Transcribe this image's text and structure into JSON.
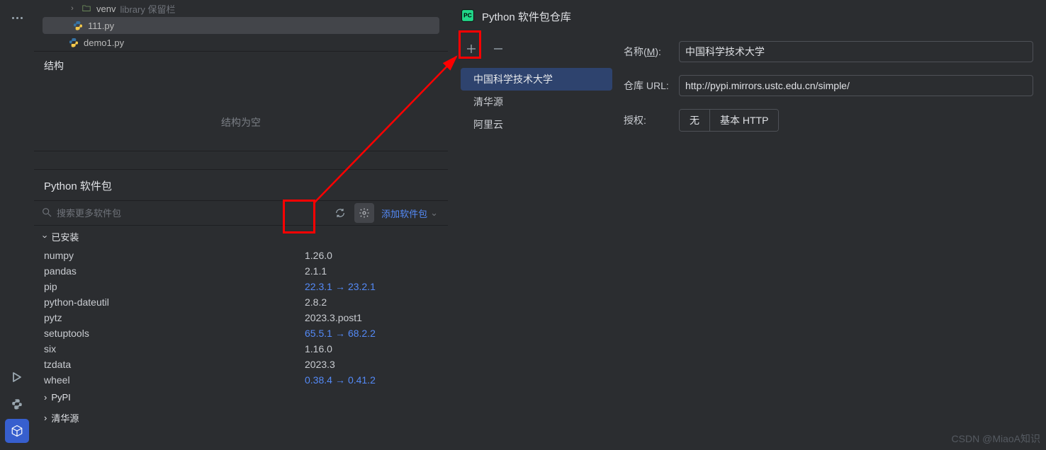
{
  "tree": {
    "venv_label": "venv",
    "venv_hint": "library 保留栏",
    "file1": "111.py",
    "file2": "demo1.py"
  },
  "structure": {
    "title": "结构",
    "empty": "结构为空"
  },
  "packages_panel": {
    "title": "Python 软件包",
    "search_placeholder": "搜索更多软件包",
    "add_package": "添加软件包",
    "installed_group": "已安装",
    "items": [
      {
        "name": "numpy",
        "version": "1.26.0"
      },
      {
        "name": "pandas",
        "version": "2.1.1"
      },
      {
        "name": "pip",
        "version": "22.3.1",
        "upgrade": "23.2.1"
      },
      {
        "name": "python-dateutil",
        "version": "2.8.2"
      },
      {
        "name": "pytz",
        "version": "2023.3.post1"
      },
      {
        "name": "setuptools",
        "version": "65.5.1",
        "upgrade": "68.2.2"
      },
      {
        "name": "six",
        "version": "1.16.0"
      },
      {
        "name": "tzdata",
        "version": "2023.3"
      },
      {
        "name": "wheel",
        "version": "0.38.4",
        "upgrade": "0.41.2"
      }
    ],
    "sections": [
      "PyPI",
      "清华源"
    ]
  },
  "dialog": {
    "title": "Python 软件包仓库",
    "repos": [
      "中国科学技术大学",
      "清华源",
      "阿里云"
    ],
    "form": {
      "name_label_prefix": "名称(",
      "name_label_key": "M",
      "name_label_suffix": "):",
      "name_value": "中国科学技术大学",
      "url_label": "仓库 URL:",
      "url_value": "http://pypi.mirrors.ustc.edu.cn/simple/",
      "auth_label": "授权:",
      "auth_none": "无",
      "auth_basic": "基本 HTTP"
    }
  },
  "watermark": "CSDN @MiaoA知识"
}
